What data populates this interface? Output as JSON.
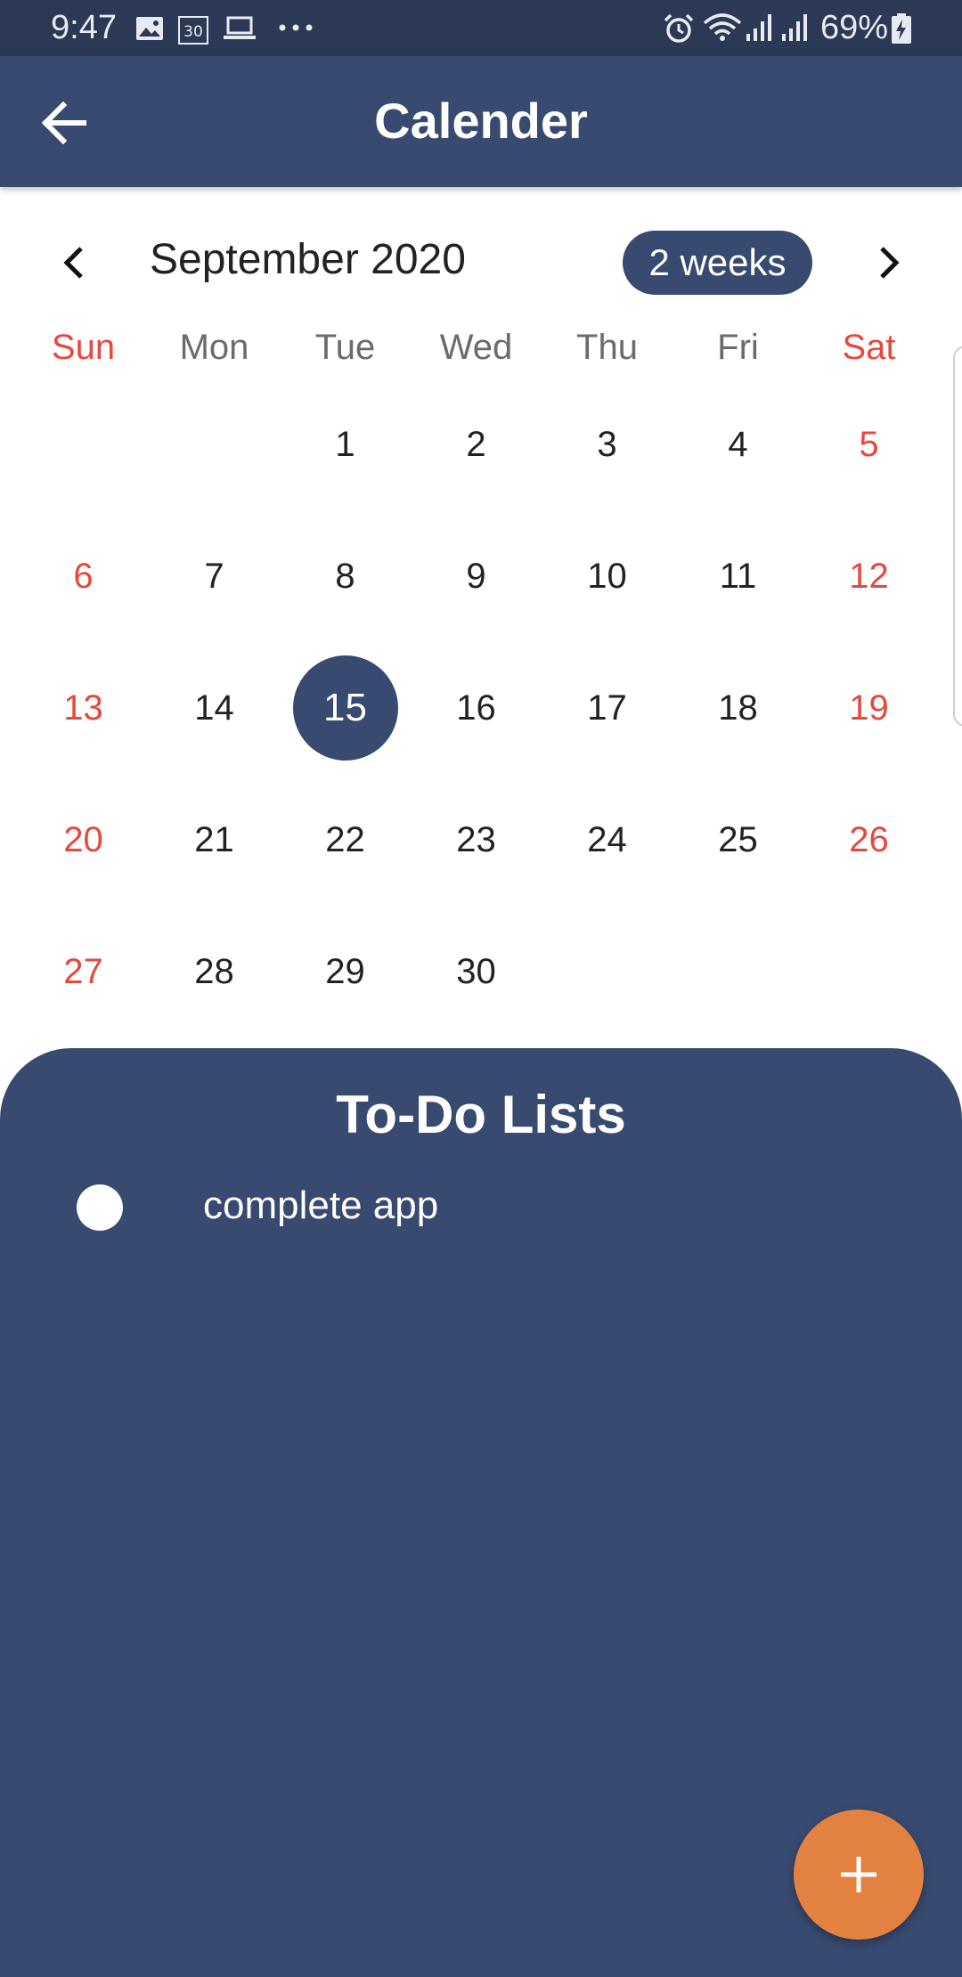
{
  "status_bar": {
    "time": "9:47",
    "battery": "69%",
    "icons_left": [
      "image-icon",
      "calendar-30-icon",
      "laptop-icon",
      "more-dots-icon"
    ],
    "icons_right": [
      "alarm-icon",
      "wifi-icon",
      "signal-icon",
      "signal-icon",
      "battery-charging-icon"
    ]
  },
  "app_bar": {
    "title": "Calender"
  },
  "calendar": {
    "month_label": "September 2020",
    "format_button": "2 weeks",
    "weekdays": [
      "Sun",
      "Mon",
      "Tue",
      "Wed",
      "Thu",
      "Fri",
      "Sat"
    ],
    "days": [
      "",
      "",
      "1",
      "2",
      "3",
      "4",
      "5",
      "6",
      "7",
      "8",
      "9",
      "10",
      "11",
      "12",
      "13",
      "14",
      "15",
      "16",
      "17",
      "18",
      "19",
      "20",
      "21",
      "22",
      "23",
      "24",
      "25",
      "26",
      "27",
      "28",
      "29",
      "30",
      "",
      "",
      ""
    ],
    "selected_day": "15"
  },
  "todo": {
    "title": "To-Do Lists",
    "items": [
      {
        "text": "complete app"
      }
    ]
  },
  "colors": {
    "status_bar": "#2b3856",
    "primary": "#384a70",
    "weekend": "#e5493d",
    "fab": "#e38240",
    "text": "#222222"
  }
}
